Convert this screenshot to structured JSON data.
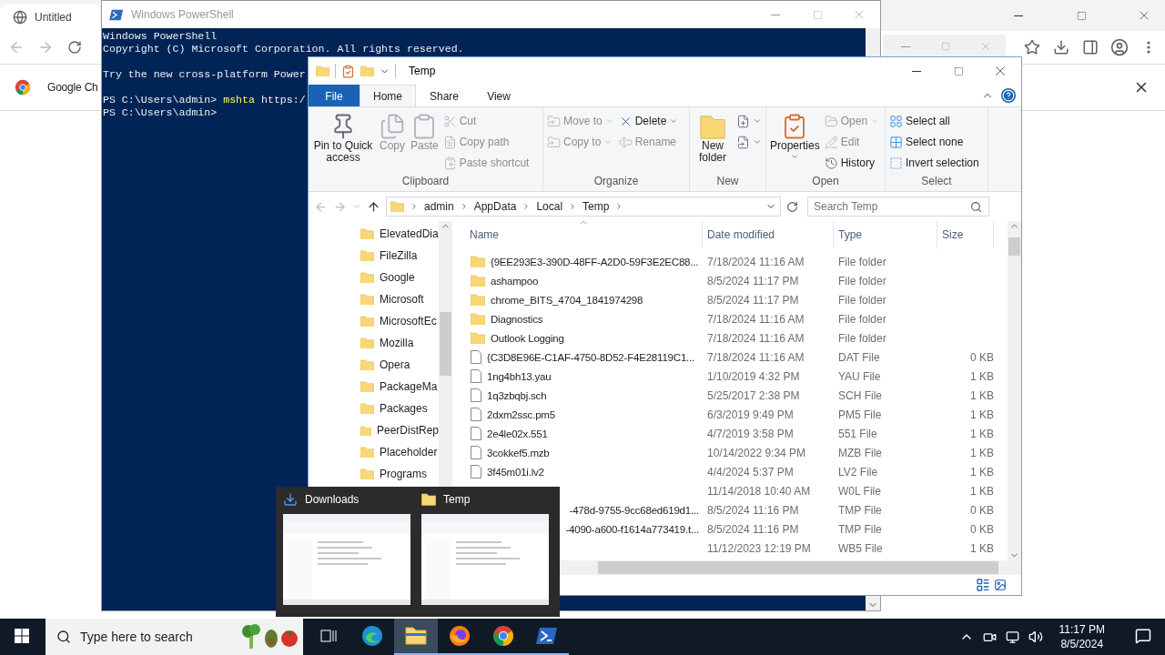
{
  "browser": {
    "tab": "Untitled",
    "infobar": "Google Ch"
  },
  "powershell": {
    "title": "Windows PowerShell",
    "lines": [
      {
        "kind": "output",
        "text": "Windows PowerShell"
      },
      {
        "kind": "output",
        "text": "Copyright (C) Microsoft Corporation. All rights reserved."
      },
      {
        "kind": "blank"
      },
      {
        "kind": "output",
        "text": "Try the new cross-platform Power"
      },
      {
        "kind": "blank"
      },
      {
        "kind": "command",
        "prompt": "PS C:\\Users\\admin>",
        "command": "mshta",
        "args": "https:/"
      },
      {
        "kind": "prompt",
        "prompt": "PS C:\\Users\\admin>"
      }
    ]
  },
  "explorer": {
    "title": "Temp",
    "tabs": [
      {
        "label": "File",
        "selected": false,
        "kind": "file"
      },
      {
        "label": "Home",
        "selected": true,
        "kind": "tab"
      },
      {
        "label": "Share",
        "selected": false,
        "kind": "tab"
      },
      {
        "label": "View",
        "selected": false,
        "kind": "tab"
      }
    ],
    "ribbon": [
      {
        "label": "Clipboard",
        "columns": [
          [
            {
              "label": "Pin to Quick access",
              "kind": "large",
              "menu": false,
              "disabled": false
            }
          ],
          [
            {
              "label": "Copy",
              "kind": "large",
              "menu": false,
              "disabled": true
            }
          ],
          [
            {
              "label": "Paste",
              "kind": "large",
              "menu": false,
              "disabled": true
            }
          ],
          [
            {
              "label": "Cut",
              "kind": "small",
              "menu": false,
              "disabled": true
            },
            {
              "label": "Copy path",
              "kind": "small",
              "menu": false,
              "disabled": true
            },
            {
              "label": "Paste shortcut",
              "kind": "small",
              "menu": false,
              "disabled": true
            }
          ]
        ]
      },
      {
        "label": "Organize",
        "columns": [
          [
            {
              "label": "Move to",
              "kind": "small",
              "menu": true,
              "disabled": true
            },
            {
              "label": "Copy to",
              "kind": "small",
              "menu": true,
              "disabled": true
            }
          ],
          [
            {
              "label": "Delete",
              "kind": "small",
              "menu": true,
              "disabled": false
            },
            {
              "label": "Rename",
              "kind": "small",
              "menu": false,
              "disabled": true
            }
          ]
        ]
      },
      {
        "label": "New",
        "columns": [
          [
            {
              "label": "New folder",
              "kind": "large",
              "menu": false,
              "disabled": false
            }
          ],
          [
            {
              "kind": "small",
              "menu": true,
              "disabled": false
            },
            {
              "kind": "small",
              "menu": true,
              "disabled": false
            }
          ]
        ]
      },
      {
        "label": "Open",
        "columns": [
          [
            {
              "label": "Properties",
              "kind": "large",
              "menu": true,
              "disabled": false
            }
          ],
          [
            {
              "label": "Open",
              "kind": "small",
              "menu": true,
              "disabled": true
            },
            {
              "label": "Edit",
              "kind": "small",
              "menu": false,
              "disabled": true
            },
            {
              "label": "History",
              "kind": "small",
              "menu": false,
              "disabled": false
            }
          ]
        ]
      },
      {
        "label": "Select",
        "columns": [
          [
            {
              "label": "Select all",
              "kind": "small",
              "menu": false,
              "disabled": false
            },
            {
              "label": "Select none",
              "kind": "small",
              "menu": false,
              "disabled": false
            },
            {
              "label": "Invert selection",
              "kind": "small",
              "menu": false,
              "disabled": false
            }
          ]
        ]
      }
    ],
    "path": [
      "admin",
      "AppData",
      "Local",
      "Temp"
    ],
    "search": {
      "placeholder": "Search Temp"
    },
    "nav": [
      "ElevatedDia",
      "FileZilla",
      "Google",
      "Microsoft",
      "MicrosoftEc",
      "Mozilla",
      "Opera",
      "PackageMa",
      "Packages",
      "PeerDistRep",
      "Placeholder",
      "Programs"
    ],
    "columns": [
      {
        "label": "Name",
        "sorted": true
      },
      {
        "label": "Date modified",
        "sorted": false
      },
      {
        "label": "Type",
        "sorted": false
      },
      {
        "label": "Size",
        "sorted": false
      }
    ],
    "rows": [
      {
        "kind": "folder",
        "name": "{9EE293E3-390D-48FF-A2D0-59F3E2EC88...",
        "date": "7/18/2024 11:16 AM",
        "type": "File folder"
      },
      {
        "kind": "folder",
        "name": "ashampoo",
        "date": "8/5/2024 11:17 PM",
        "type": "File folder"
      },
      {
        "kind": "folder",
        "name": "chrome_BITS_4704_1841974298",
        "date": "8/5/2024 11:17 PM",
        "type": "File folder"
      },
      {
        "kind": "folder",
        "name": "Diagnostics",
        "date": "7/18/2024 11:16 AM",
        "type": "File folder"
      },
      {
        "kind": "folder",
        "name": "Outlook Logging",
        "date": "7/18/2024 11:16 AM",
        "type": "File folder"
      },
      {
        "kind": "file",
        "name": "{C3D8E96E-C1AF-4750-8D52-F4E28119C1...",
        "date": "7/18/2024 11:16 AM",
        "type": "DAT File",
        "size": "0 KB"
      },
      {
        "kind": "file",
        "name": "1ng4bh13.yau",
        "date": "1/10/2019 4:32 PM",
        "type": "YAU File",
        "size": "1 KB"
      },
      {
        "kind": "file",
        "name": "1q3zbqbj.sch",
        "date": "5/25/2017 2:38 PM",
        "type": "SCH File",
        "size": "1 KB"
      },
      {
        "kind": "file",
        "name": "2dxm2ssc.pm5",
        "date": "6/3/2019 9:49 PM",
        "type": "PM5 File",
        "size": "1 KB"
      },
      {
        "kind": "file",
        "name": "2e4le02x.551",
        "date": "4/7/2019 3:58 PM",
        "type": "551 File",
        "size": "1 KB"
      },
      {
        "kind": "file",
        "name": "3cokkef5.mzb",
        "date": "10/14/2022 9:34 PM",
        "type": "MZB File",
        "size": "1 KB"
      },
      {
        "kind": "file",
        "name": "3f45m01i.lv2",
        "date": "4/4/2024 5:37 PM",
        "type": "LV2 File",
        "size": "1 KB"
      },
      {
        "kind": "hidden",
        "date": "11/14/2018 10:40 AM",
        "type": "W0L File",
        "size": "1 KB"
      },
      {
        "kind": "clipped",
        "name": "-478d-9755-9cc68ed619d1...",
        "date": "8/5/2024 11:16 PM",
        "type": "TMP File",
        "size": "0 KB"
      },
      {
        "kind": "clipped",
        "name": "-4090-a600-f1614a773419.t...",
        "date": "8/5/2024 11:16 PM",
        "type": "TMP File",
        "size": "0 KB"
      },
      {
        "kind": "hidden",
        "date": "11/12/2023 12:19 PM",
        "type": "WB5 File",
        "size": "1 KB"
      }
    ]
  },
  "previews": [
    {
      "label": "Downloads",
      "kind": "downloads"
    },
    {
      "label": "Temp",
      "kind": "folder"
    }
  ],
  "taskbar": {
    "search": {
      "placeholder": "Type here to search"
    },
    "apps": [
      {
        "kind": "edge",
        "selected": false,
        "running": false
      },
      {
        "kind": "explorer",
        "selected": true,
        "running": true
      },
      {
        "kind": "firefox",
        "selected": false,
        "running": true
      },
      {
        "kind": "chrome",
        "selected": false,
        "running": true
      },
      {
        "kind": "powershell",
        "selected": false,
        "running": true
      }
    ],
    "time": "11:17 PM",
    "date": "8/5/2024"
  }
}
